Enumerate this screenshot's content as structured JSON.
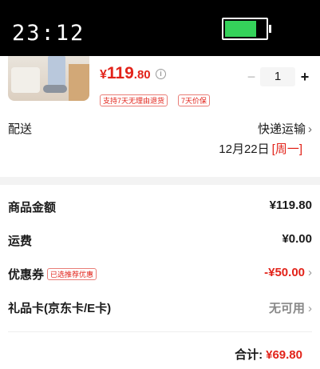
{
  "status_bar": {
    "time": "23:12",
    "battery_level": 0.78
  },
  "product": {
    "price_currency": "¥",
    "price_integer": "119",
    "price_decimal": ".80",
    "quantity": "1",
    "minus_label": "−",
    "plus_label": "+",
    "tags": [
      "支持7天无理由退货",
      "7天价保"
    ]
  },
  "shipping": {
    "label": "配送",
    "method": "快递运输",
    "date": "12月22日",
    "weekday": "[周一]"
  },
  "summary": {
    "rows": [
      {
        "label": "商品金额",
        "value": "¥119.80"
      },
      {
        "label": "运费",
        "value": "¥0.00"
      },
      {
        "label": "优惠券",
        "badge": "已选推荐优惠",
        "value": "-¥50.00"
      },
      {
        "label": "礼品卡(京东卡/E卡)",
        "value": "无可用"
      }
    ],
    "total_label": "合计:",
    "total_value": "¥69.80"
  },
  "colors": {
    "accent": "#e2231a",
    "battery": "#35d25a"
  }
}
